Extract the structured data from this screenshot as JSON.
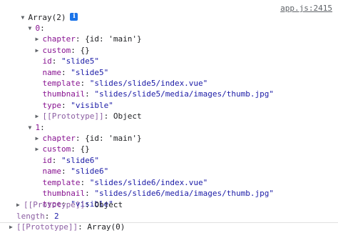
{
  "console": {
    "source_link": "app.js:2415",
    "header": {
      "label": "Array(2)",
      "info_icon": "i"
    },
    "items": [
      {
        "index": "0",
        "chapter_key": "chapter",
        "chapter_val": "{id: 'main'}",
        "custom_key": "custom",
        "custom_val": "{}",
        "id_key": "id",
        "id_val": "\"slide5\"",
        "name_key": "name",
        "name_val": "\"slide5\"",
        "template_key": "template",
        "template_val": "\"slides/slide5/index.vue\"",
        "thumbnail_key": "thumbnail",
        "thumbnail_val": "\"slides/slide5/media/images/thumb.jpg\"",
        "type_key": "type",
        "type_val": "\"visible\"",
        "proto_key": "[[Prototype]]",
        "proto_val": "Object"
      },
      {
        "index": "1",
        "chapter_key": "chapter",
        "chapter_val": "{id: 'main'}",
        "custom_key": "custom",
        "custom_val": "{}",
        "id_key": "id",
        "id_val": "\"slide6\"",
        "name_key": "name",
        "name_val": "\"slide6\"",
        "template_key": "template",
        "template_val": "\"slides/slide6/index.vue\"",
        "thumbnail_key": "thumbnail",
        "thumbnail_val": "\"slides/slide6/media/images/thumb.jpg\"",
        "type_key": "type",
        "type_val": "\"visible\"",
        "proto_key": "[[Prototype]]",
        "proto_val": "Object"
      }
    ],
    "length_key": "length",
    "length_val": "2",
    "array_proto_key": "[[Prototype]]",
    "array_proto_val": "Array(0)"
  }
}
